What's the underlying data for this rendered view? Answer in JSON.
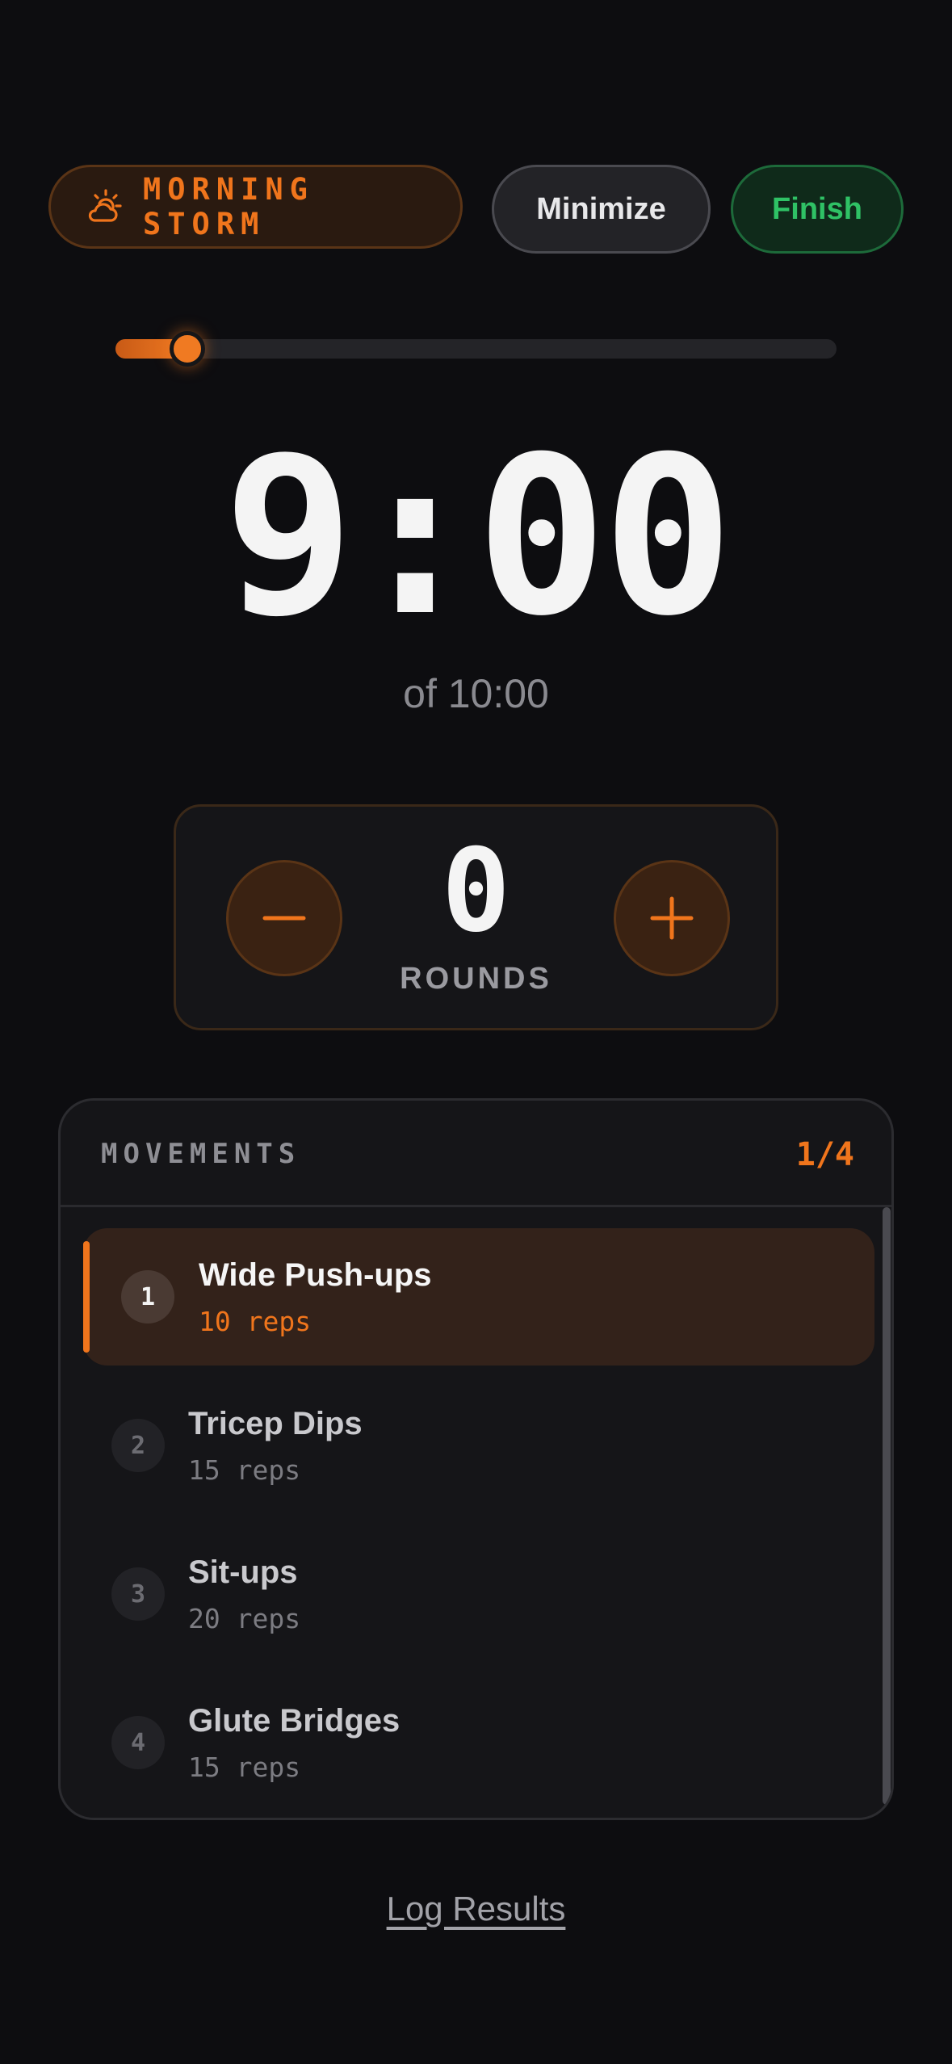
{
  "header": {
    "workout_name": "MORNING STORM",
    "workout_icon": "sun-cloud-icon",
    "minimize_label": "Minimize",
    "finish_label": "Finish"
  },
  "progress": {
    "fraction": 0.1
  },
  "timer": {
    "remaining": "9:00",
    "total_label": "of 10:00"
  },
  "rounds": {
    "value": "0",
    "label": "ROUNDS",
    "decrement_icon": "minus-icon",
    "increment_icon": "plus-icon"
  },
  "movements": {
    "title": "MOVEMENTS",
    "counter": "1/4",
    "items": [
      {
        "number": "1",
        "name": "Wide Push-ups",
        "reps": "10 reps",
        "active": true
      },
      {
        "number": "2",
        "name": "Tricep Dips",
        "reps": "15 reps",
        "active": false
      },
      {
        "number": "3",
        "name": "Sit-ups",
        "reps": "20 reps",
        "active": false
      },
      {
        "number": "4",
        "name": "Glute Bridges",
        "reps": "15 reps",
        "active": false
      }
    ]
  },
  "footer": {
    "log_results_label": "Log Results"
  },
  "colors": {
    "accent": "#f0751c",
    "success": "#2fc165",
    "background": "#0d0d10"
  }
}
